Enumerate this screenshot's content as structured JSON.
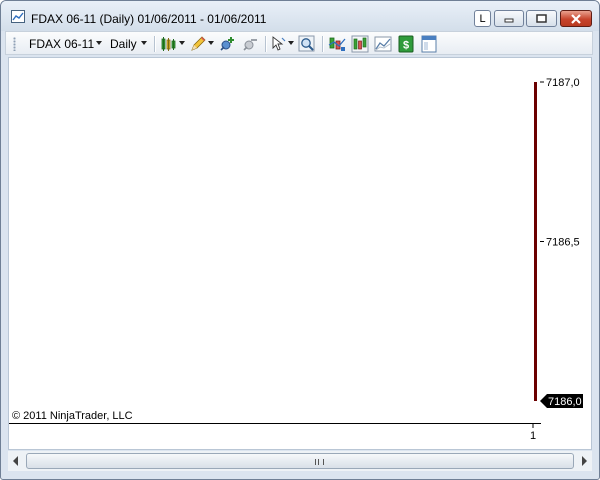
{
  "window": {
    "title": "FDAX 06-11 (Daily)  01/06/2011 - 01/06/2011",
    "button_l_label": "L"
  },
  "toolbar": {
    "instrument": "FDAX 06-11",
    "interval": "Daily",
    "icons": [
      "bar-type-icon",
      "drawing-tools-icon",
      "add-indicator-icon",
      "remove-indicator-icon",
      "pointer-tool-icon",
      "zoom-icon",
      "indicators-icon",
      "strategies-icon",
      "chart-style-icon",
      "dollar-icon",
      "properties-icon"
    ]
  },
  "chart": {
    "copyright": "© 2011 NinjaTrader, LLC",
    "bar_color": "#6b0000",
    "price_labels": [
      "7187,0",
      "7186,5"
    ],
    "current_price": "7186,0",
    "x_tick": "1"
  },
  "chart_data": {
    "type": "bar",
    "categories": [
      "1"
    ],
    "series": [
      {
        "open": 7186.0,
        "high": 7187.0,
        "low": 7186.0,
        "close": 7186.0
      }
    ],
    "ylim": [
      7186.0,
      7187.0
    ],
    "y_ticks": [
      "7187,0",
      "7186,5"
    ],
    "current_price": "7186,0"
  }
}
